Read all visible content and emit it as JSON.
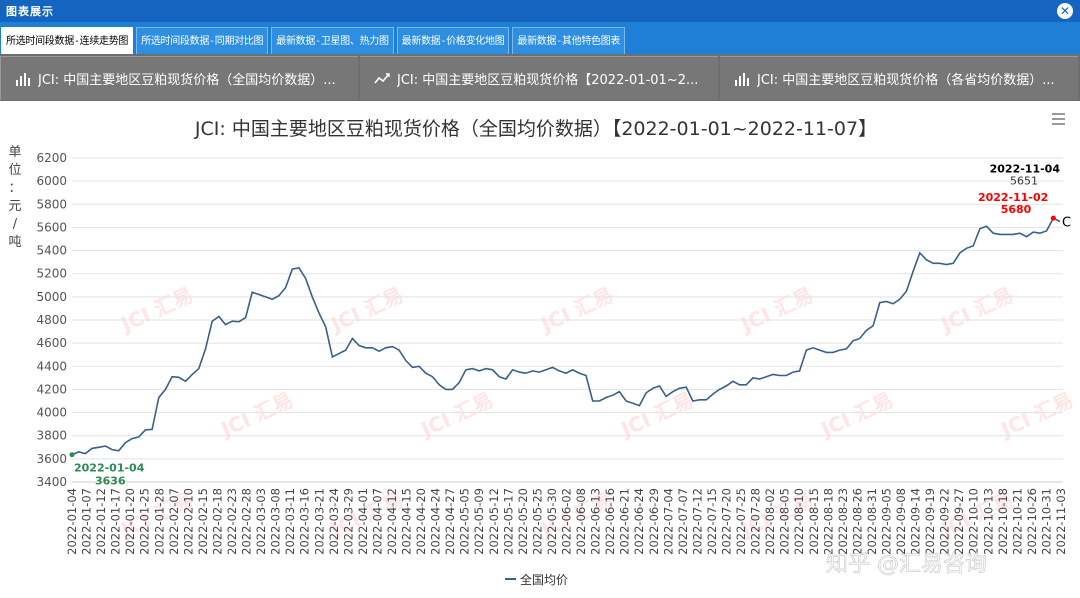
{
  "window": {
    "title": "图表展示",
    "close_icon": "close-icon"
  },
  "tabs": [
    {
      "label": "所选时间段数据-连续走势图",
      "active": true
    },
    {
      "label": "所选时间段数据-同期对比图",
      "active": false
    },
    {
      "label": "最新数据-卫星图、热力图",
      "active": false
    },
    {
      "label": "最新数据-价格变化地图",
      "active": false
    },
    {
      "label": "最新数据-其他特色图表",
      "active": false
    }
  ],
  "subtabs": [
    {
      "icon": "bar-chart-icon",
      "label": "JCI: 中国主要地区豆粕现货价格（全国均价数据）..."
    },
    {
      "icon": "line-chart-icon",
      "label": "JCI: 中国主要地区豆粕现货价格【2022-01-01~2..."
    },
    {
      "icon": "bar-chart-icon",
      "label": "JCI: 中国主要地区豆粕现货价格（各省均价数据）..."
    }
  ],
  "colors": {
    "series": "#3a5f8a",
    "min_label": "#2e8b57",
    "max_label": "#ff0000",
    "last_label": "#000000"
  },
  "chart_data": {
    "type": "line",
    "title": "JCI: 中国主要地区豆粕现货价格（全国均价数据）【2022-01-01~2022-11-07】",
    "ylabel": "单位：元/吨",
    "ylim": [
      3400,
      6200
    ],
    "yticks": [
      3400,
      3600,
      3800,
      4000,
      4200,
      4400,
      4600,
      4800,
      5000,
      5200,
      5400,
      5600,
      5800,
      6000,
      6200
    ],
    "grid": true,
    "legend": {
      "position": "bottom",
      "entries": [
        "全国均价"
      ]
    },
    "xtick_labels": [
      "2022-01-04",
      "2022-01-07",
      "2022-01-12",
      "2022-01-17",
      "2022-01-20",
      "2022-01-25",
      "2022-01-28",
      "2022-02-07",
      "2022-02-10",
      "2022-02-15",
      "2022-02-18",
      "2022-02-23",
      "2022-02-28",
      "2022-03-03",
      "2022-03-08",
      "2022-03-11",
      "2022-03-16",
      "2022-03-21",
      "2022-03-24",
      "2022-03-29",
      "2022-04-01",
      "2022-04-07",
      "2022-04-12",
      "2022-04-15",
      "2022-04-20",
      "2022-04-24",
      "2022-04-27",
      "2022-05-05",
      "2022-05-09",
      "2022-05-12",
      "2022-05-17",
      "2022-05-20",
      "2022-05-25",
      "2022-05-30",
      "2022-06-02",
      "2022-06-08",
      "2022-06-13",
      "2022-06-16",
      "2022-06-21",
      "2022-06-24",
      "2022-06-29",
      "2022-07-04",
      "2022-07-07",
      "2022-07-12",
      "2022-07-15",
      "2022-07-20",
      "2022-07-25",
      "2022-07-28",
      "2022-08-02",
      "2022-08-05",
      "2022-08-10",
      "2022-08-15",
      "2022-08-18",
      "2022-08-23",
      "2022-08-26",
      "2022-08-31",
      "2022-09-05",
      "2022-09-08",
      "2022-09-14",
      "2022-09-19",
      "2022-09-22",
      "2022-09-27",
      "2022-10-10",
      "2022-10-13",
      "2022-10-18",
      "2022-10-21",
      "2022-10-26",
      "2022-10-31",
      "2022-11-03"
    ],
    "series": [
      {
        "name": "全国均价",
        "values": [
          3636,
          3660,
          3645,
          3690,
          3700,
          3710,
          3680,
          3670,
          3740,
          3775,
          3790,
          3850,
          3855,
          4130,
          4200,
          4310,
          4305,
          4270,
          4330,
          4380,
          4550,
          4790,
          4830,
          4760,
          4790,
          4785,
          4820,
          5040,
          5020,
          5000,
          4980,
          5010,
          5080,
          5240,
          5250,
          5160,
          5000,
          4860,
          4740,
          4480,
          4510,
          4540,
          4640,
          4580,
          4560,
          4560,
          4530,
          4560,
          4570,
          4540,
          4450,
          4390,
          4400,
          4340,
          4310,
          4240,
          4200,
          4200,
          4260,
          4370,
          4380,
          4360,
          4380,
          4370,
          4310,
          4290,
          4370,
          4350,
          4340,
          4360,
          4350,
          4370,
          4390,
          4360,
          4340,
          4370,
          4340,
          4320,
          4100,
          4100,
          4130,
          4150,
          4180,
          4100,
          4080,
          4060,
          4170,
          4210,
          4230,
          4140,
          4180,
          4210,
          4220,
          4100,
          4110,
          4110,
          4160,
          4200,
          4230,
          4270,
          4240,
          4240,
          4300,
          4290,
          4310,
          4330,
          4320,
          4320,
          4350,
          4360,
          4540,
          4560,
          4540,
          4520,
          4520,
          4540,
          4550,
          4620,
          4640,
          4710,
          4750,
          4950,
          4960,
          4940,
          4980,
          5050,
          5220,
          5380,
          5320,
          5290,
          5290,
          5280,
          5290,
          5380,
          5420,
          5440,
          5590,
          5610,
          5550,
          5540,
          5540,
          5540,
          5550,
          5520,
          5560,
          5550,
          5570,
          5680,
          5651
        ],
        "annotations": [
          {
            "label": "2022-01-04",
            "value": "3636",
            "kind": "min"
          },
          {
            "label": "2022-11-02",
            "value": "5680",
            "kind": "max"
          },
          {
            "label": "2022-11-04",
            "value": "5651",
            "kind": "last"
          }
        ]
      }
    ],
    "watermark": "JCI 汇易",
    "source_watermark": "知乎 @汇易咨询"
  }
}
